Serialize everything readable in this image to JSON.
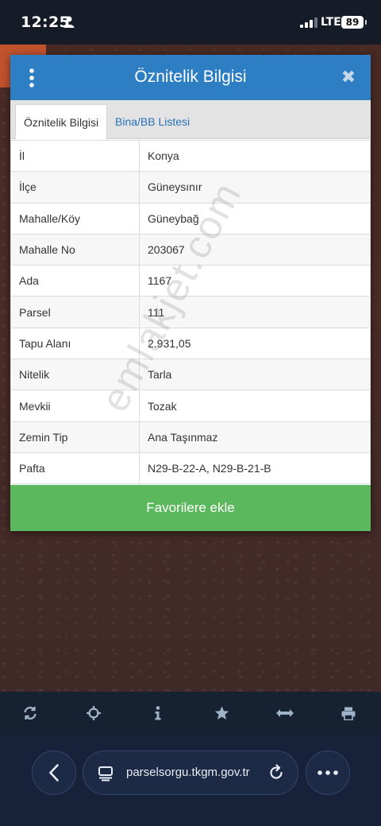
{
  "status_bar": {
    "time": "12:25",
    "network": "LTE",
    "battery": "89"
  },
  "dialog": {
    "title": "Öznitelik Bilgisi",
    "close_label": "✖",
    "tabs": [
      {
        "label": "Öznitelik Bilgisi",
        "active": true
      },
      {
        "label": "Bina/BB Listesi",
        "active": false
      }
    ],
    "rows": [
      {
        "key": "İl",
        "value": "Konya"
      },
      {
        "key": "İlçe",
        "value": "Güneysınır"
      },
      {
        "key": "Mahalle/Köy",
        "value": "Güneybağ"
      },
      {
        "key": "Mahalle No",
        "value": "203067"
      },
      {
        "key": "Ada",
        "value": "1167"
      },
      {
        "key": "Parsel",
        "value": "111"
      },
      {
        "key": "Tapu Alanı",
        "value": "2.931,05"
      },
      {
        "key": "Nitelik",
        "value": "Tarla"
      },
      {
        "key": "Mevkii",
        "value": "Tozak"
      },
      {
        "key": "Zemin Tip",
        "value": "Ana Taşınmaz"
      },
      {
        "key": "Pafta",
        "value": "N29-B-22-A, N29-B-21-B"
      }
    ],
    "favorite_label": "Favorilere ekle"
  },
  "watermark": "emlakjet.com",
  "toolbar": {
    "icons": [
      "refresh-icon",
      "locate-icon",
      "info-icon",
      "star-icon",
      "measure-icon",
      "print-icon"
    ]
  },
  "browser": {
    "url": "parselsorgu.tkgm.gov.tr"
  },
  "colors": {
    "header": "#2e7ec4",
    "favorite": "#5cb85c",
    "link": "#2a72b8"
  }
}
